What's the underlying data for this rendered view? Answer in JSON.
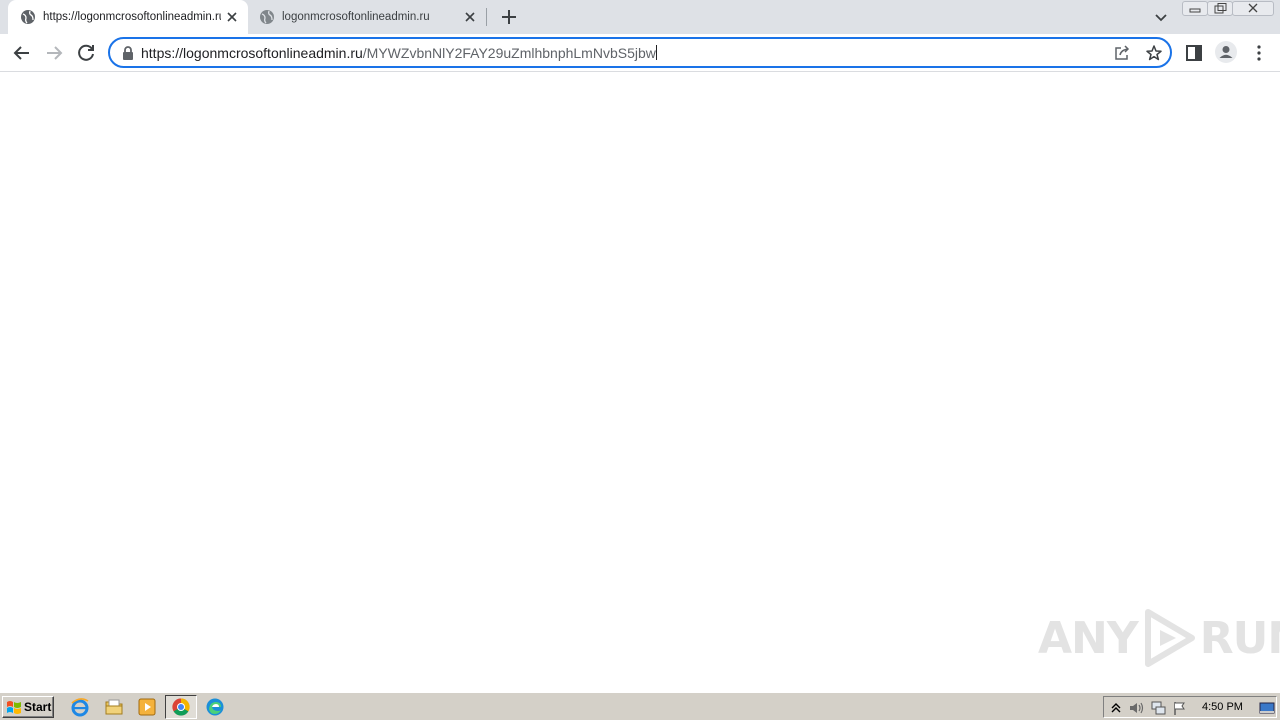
{
  "browser": {
    "tabs": [
      {
        "title": "https://logonmcrosoftonlineadmin.ru/",
        "active": true,
        "icon": "globe-icon"
      },
      {
        "title": "logonmcrosoftonlineadmin.ru",
        "active": false,
        "icon": "globe-icon"
      }
    ],
    "address_bar": {
      "url_host": "https://logonmcrosoftonlineadmin.ru",
      "url_path": "/MYWZvbnNlY2FAY29uZmlhbnphLmNvbS5jbw",
      "focused": true
    },
    "colors": {
      "accent": "#1a73e8",
      "tabstrip": "#dee1e6"
    }
  },
  "page": {
    "blank": true
  },
  "watermark": {
    "text_left": "ANY",
    "text_right": "RUN"
  },
  "taskbar": {
    "start_label": "Start",
    "quick_launch": [
      "internet-explorer-icon",
      "folder-icon",
      "media-player-icon",
      "chrome-icon",
      "edge-icon"
    ],
    "clock": "4:50 PM"
  }
}
